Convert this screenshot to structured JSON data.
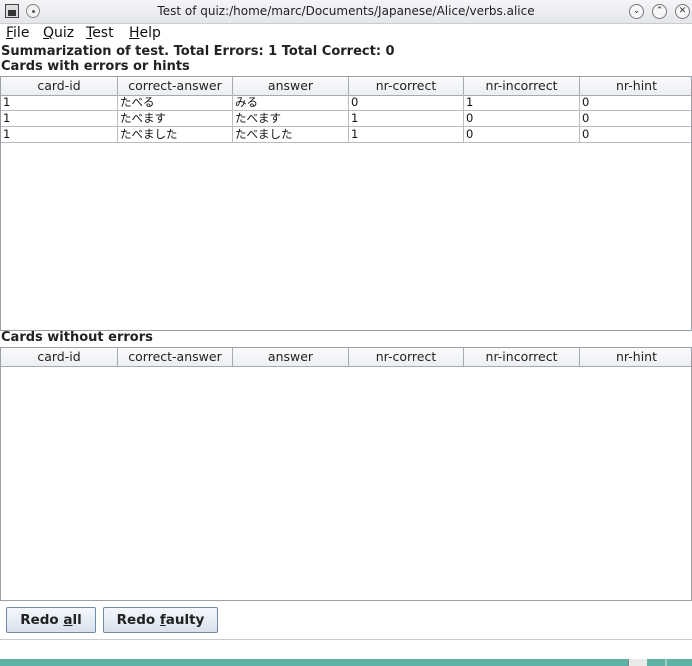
{
  "window": {
    "title": "Test of quiz:/home/marc/Documents/Japanese/Alice/verbs.alice"
  },
  "menu": [
    {
      "mnemonic": "F",
      "rest": "ile"
    },
    {
      "mnemonic": "Q",
      "rest": "uiz"
    },
    {
      "mnemonic": "T",
      "rest": "est"
    },
    {
      "mnemonic": "H",
      "rest": "elp"
    }
  ],
  "summary": "Summarization of test. Total Errors: 1 Total Correct: 0",
  "errors_section": {
    "title": "Cards with errors or hints",
    "columns": [
      "card-id",
      "correct-answer",
      "answer",
      "nr-correct",
      "nr-incorrect",
      "nr-hint"
    ],
    "rows": [
      [
        "1",
        "たべる",
        "みる",
        "0",
        "1",
        "0"
      ],
      [
        "1",
        "たべます",
        "たべます",
        "1",
        "0",
        "0"
      ],
      [
        "1",
        "たべました",
        "たべました",
        "1",
        "0",
        "0"
      ]
    ]
  },
  "ok_section": {
    "title": "Cards without errors",
    "columns": [
      "card-id",
      "correct-answer",
      "answer",
      "nr-correct",
      "nr-incorrect",
      "nr-hint"
    ],
    "rows": []
  },
  "buttons": {
    "redo_all": {
      "before": "Redo ",
      "mnemonic": "a",
      "after": "ll"
    },
    "redo_faulty": {
      "before": "Redo ",
      "mnemonic": "f",
      "after": "aulty"
    }
  }
}
